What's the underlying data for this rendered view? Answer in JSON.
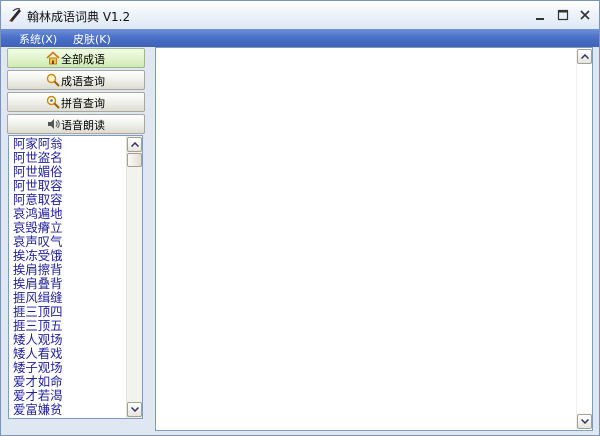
{
  "window": {
    "title": "翰林成语词典  V1.2",
    "controls": {
      "minimize": "–",
      "maximize": "□",
      "close": "✕"
    }
  },
  "menu": [
    {
      "label": "系统(X)"
    },
    {
      "label": "皮肤(K)"
    }
  ],
  "nav": [
    {
      "label": "全部成语",
      "icon": "home-icon",
      "active": true
    },
    {
      "label": "成语查询",
      "icon": "magnifier-icon",
      "active": false
    },
    {
      "label": "拼音查询",
      "icon": "magnifier-plus-icon",
      "active": false
    },
    {
      "label": "语音朗读",
      "icon": "speaker-icon",
      "active": false
    }
  ],
  "idioms": [
    "阿家阿翁",
    "阿世盗名",
    "阿世媚俗",
    "阿世取容",
    "阿意取容",
    "哀鸿遍地",
    "哀毁瘠立",
    "哀声叹气",
    "挨冻受饿",
    "挨肩擦背",
    "挨肩叠背",
    "捱风缉缝",
    "捱三顶四",
    "捱三顶五",
    "矮人观场",
    "矮人看戏",
    "矮子观场",
    "爱才如命",
    "爱才若渴",
    "爱富嫌贫"
  ],
  "colors": {
    "menubar": "#4a6fc6",
    "list_text": "#21219c",
    "active_button": "#e3f5cf"
  }
}
